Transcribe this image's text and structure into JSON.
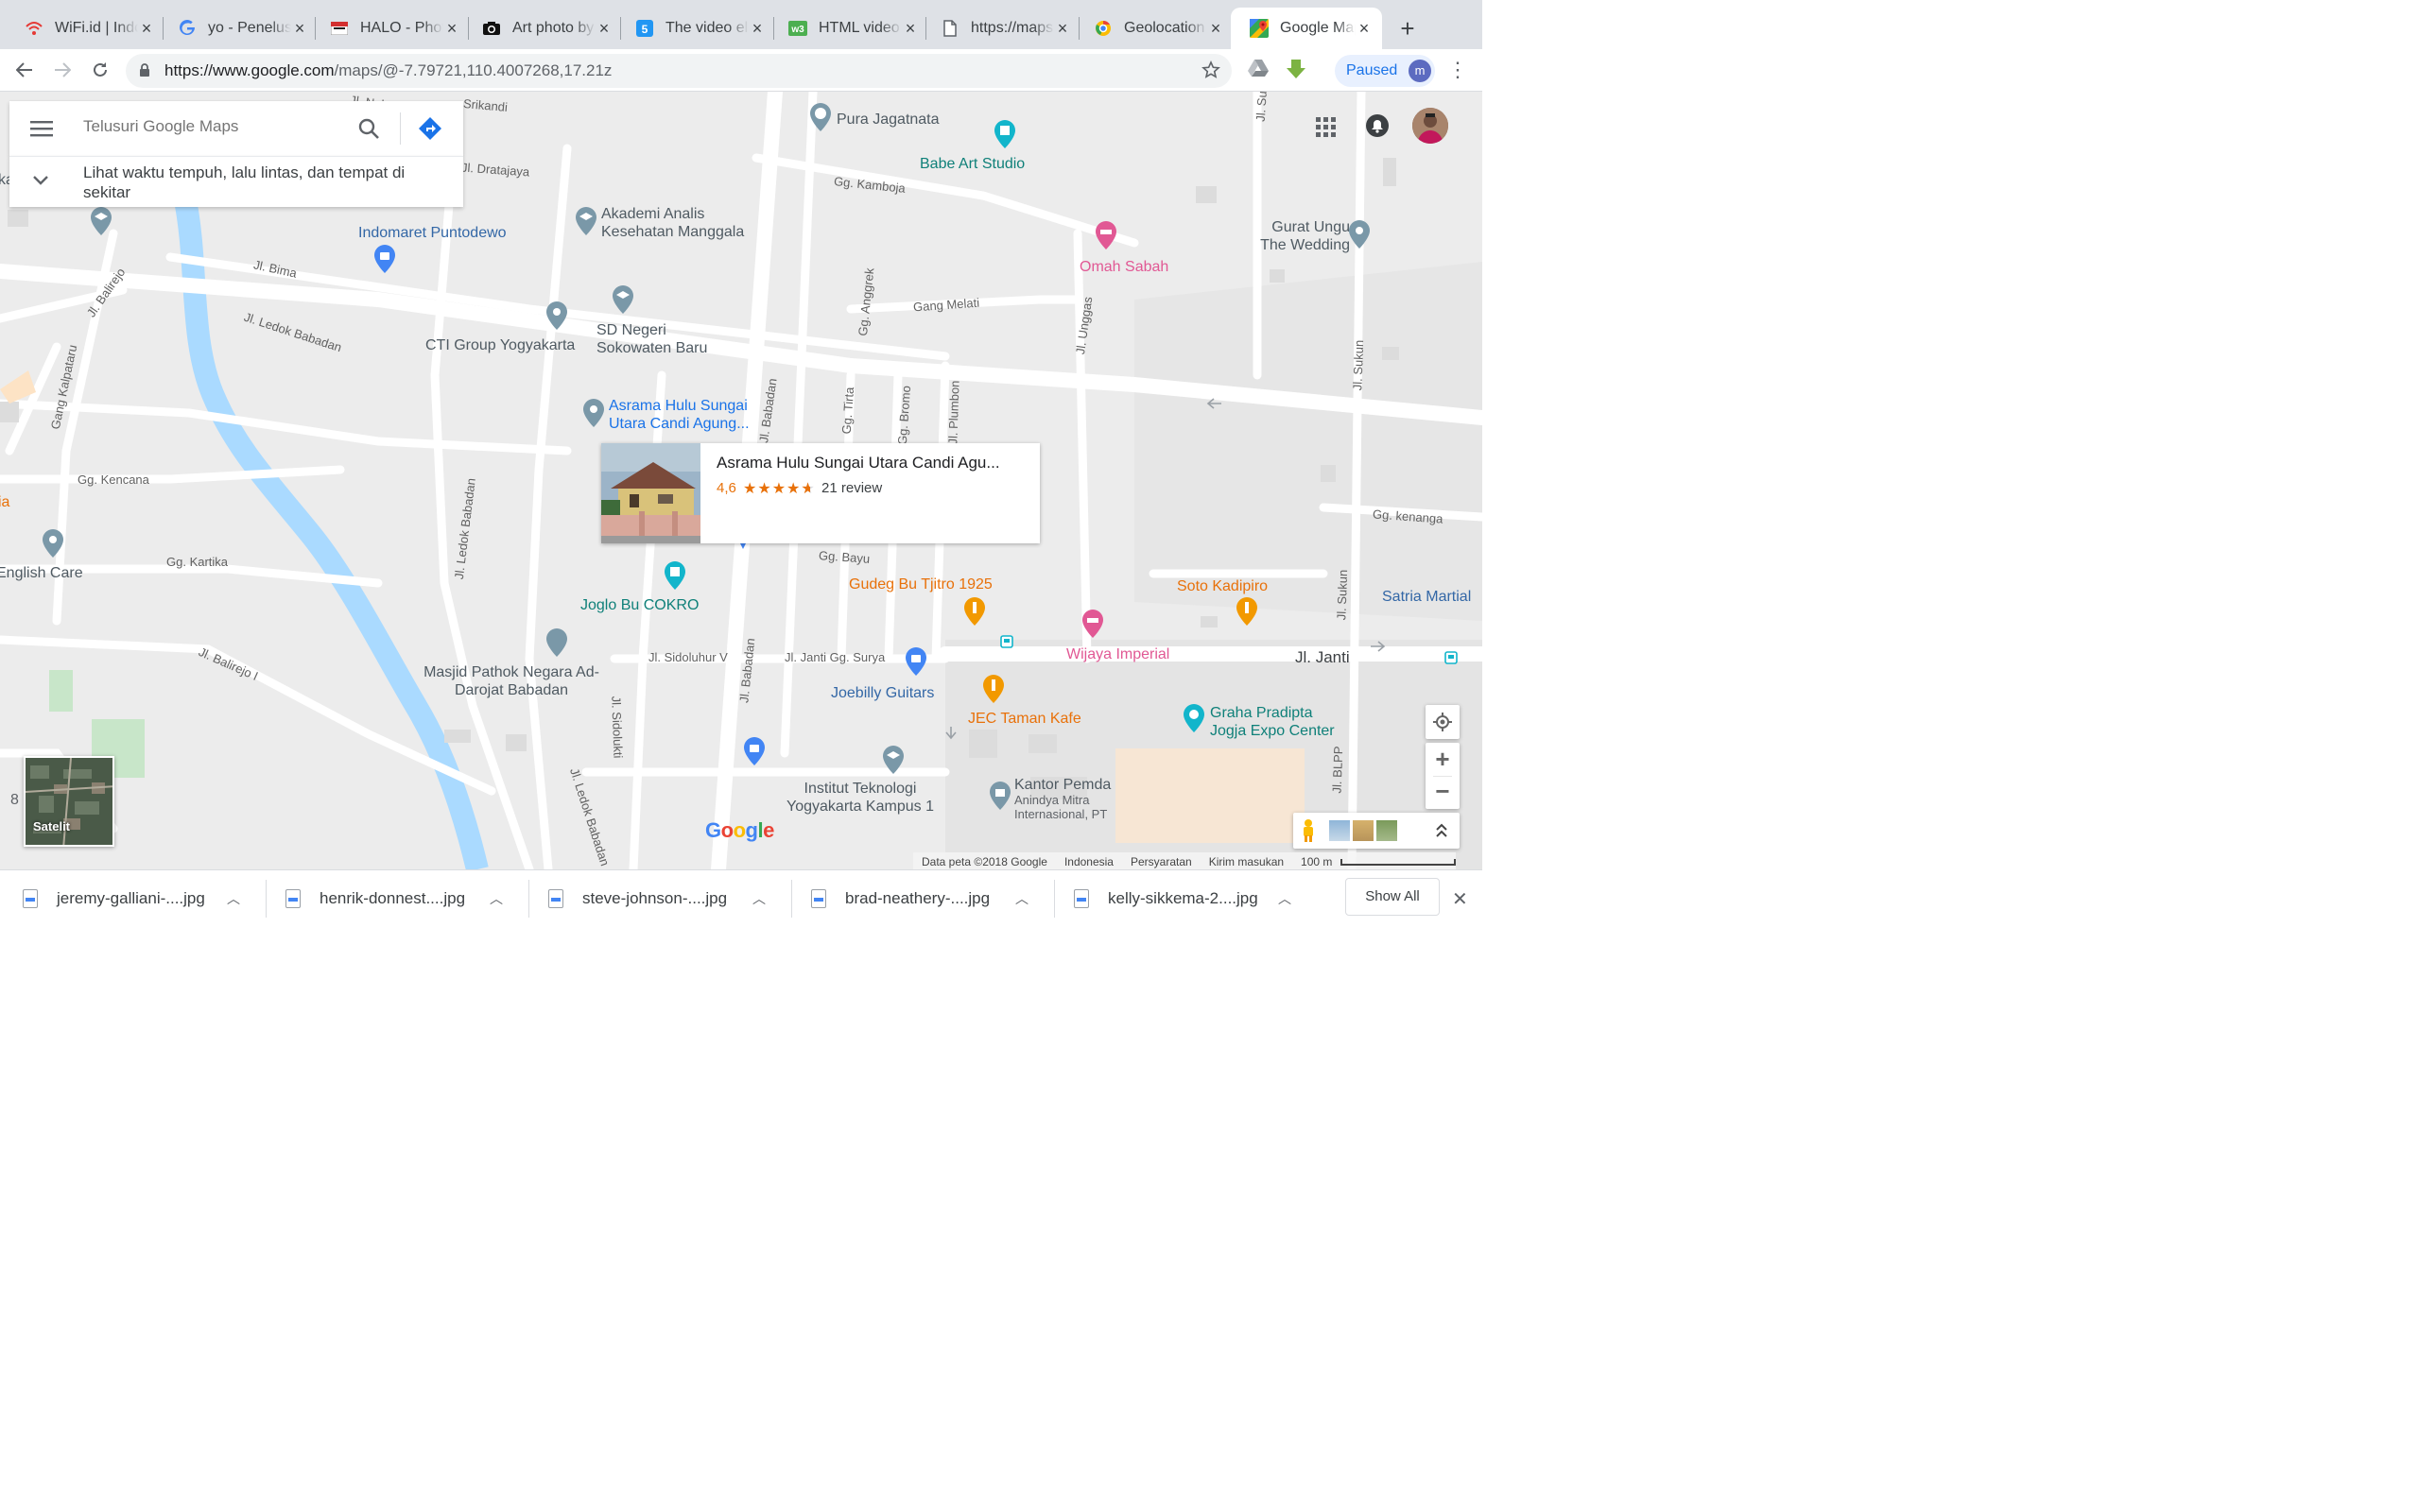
{
  "browser": {
    "tabs": [
      {
        "title": "WiFi.id | Indonesia",
        "favicon": "wifi-icon",
        "active": false
      },
      {
        "title": "yo - Penelusuran Google",
        "favicon": "google-icon",
        "active": false
      },
      {
        "title": "HALO - Photo",
        "favicon": "flag-icon",
        "active": false
      },
      {
        "title": "Art photo by",
        "favicon": "camera-icon",
        "active": false
      },
      {
        "title": "The video element",
        "favicon": "html5-icon",
        "active": false
      },
      {
        "title": "HTML video",
        "favicon": "w3-icon",
        "active": false
      },
      {
        "title": "https://maps",
        "favicon": "page-icon",
        "active": false
      },
      {
        "title": "Geolocation",
        "favicon": "chrome-icon",
        "active": false
      },
      {
        "title": "Google Maps",
        "favicon": "maps-icon",
        "active": true
      }
    ],
    "url_host": "https://www.google.com",
    "url_path": "/maps/@-7.79721,110.4007268,17.21z",
    "profile_status": "Paused",
    "profile_initial": "m"
  },
  "search": {
    "placeholder": "Telusuri Google Maps",
    "suggestion": "Lihat waktu tempuh, lalu lintas, dan tempat di sekitar"
  },
  "map": {
    "streets": [
      "Jl. Nakula",
      "Srikandi",
      "Jl. Dratajaya",
      "Jl. Bima",
      "Jl. Balirejo",
      "Jl. Ledok Babadan",
      "Gang Kalpataru",
      "Gg. Kencana",
      "Gg. Kartika",
      "Jl. Balirejo I",
      "Jl. Ledok Babadan",
      "Jl. Sidolukti",
      "Jl. Sidoluhur V",
      "Jl. Babadan",
      "Jl. Babadan",
      "Gg. Kamboja",
      "Gang Melati",
      "Gg. Anggrek",
      "Jl. Unggas",
      "Gg. Tirta",
      "Gg. Bromo",
      "Jl. Plumbon",
      "Gg. Bayu",
      "Jl. Janti Gg. Surya",
      "Jl. Janti",
      "Jl. Sukun",
      "Jl. Sukun",
      "Gg. kenanga",
      "Jl. BLPP",
      "Jl. Ledok Babadan",
      "Jl. Su"
    ],
    "places": [
      {
        "name": "Pura Jagatnata",
        "kind": "temple"
      },
      {
        "name": "Babe Art Studio",
        "kind": "museum"
      },
      {
        "name": "Akademi Analis Kesehatan Manggala",
        "kind": "school"
      },
      {
        "name": "Indomaret Puntodewo",
        "kind": "shop"
      },
      {
        "name": "Gurat Ungu The Wedding",
        "kind": "place"
      },
      {
        "name": "Omah Sabah",
        "kind": "hotel"
      },
      {
        "name": "CTI Group Yogyakarta",
        "kind": "place"
      },
      {
        "name": "SD Negeri Sokowaten Baru",
        "kind": "school"
      },
      {
        "name": "Asrama Hulu Sungai Utara Candi Agung...",
        "kind": "selected"
      },
      {
        "name": "English Care",
        "kind": "place"
      },
      {
        "name": "Joglo Bu COKRO",
        "kind": "museum"
      },
      {
        "name": "Gudeg Bu Tjitro 1925",
        "kind": "restaurant"
      },
      {
        "name": "Soto Kadipiro",
        "kind": "restaurant"
      },
      {
        "name": "Satria Martial",
        "kind": "place"
      },
      {
        "name": "Wijaya Imperial",
        "kind": "hotel"
      },
      {
        "name": "Masjid Pathok Negara Ad-Darojat Babadan",
        "kind": "mosque"
      },
      {
        "name": "Joebilly Guitars",
        "kind": "shop"
      },
      {
        "name": "JEC Taman Kafe",
        "kind": "restaurant"
      },
      {
        "name": "Graha Pradipta Jogja Expo Center",
        "kind": "venue"
      },
      {
        "name": "Institut Teknologi Yogyakarta Kampus 1",
        "kind": "school"
      },
      {
        "name": "Kantor Pemda",
        "kind": "government"
      },
      {
        "name": "Anindya Mitra Internasional, PT",
        "kind": "company"
      },
      {
        "name": "ia",
        "kind": "place"
      },
      {
        "name": "ka",
        "kind": "place"
      }
    ],
    "card": {
      "title": "Asrama Hulu Sungai Utara Candi Agu...",
      "rating": "4,6",
      "stars": 4.6,
      "reviews": "21 review"
    },
    "satellite_label": "Satelit",
    "edge_digit": "8",
    "attribution": {
      "data": "Data peta ©2018 Google",
      "country": "Indonesia",
      "terms": "Persyaratan",
      "feedback": "Kirim masukan",
      "scale": "100 m"
    }
  },
  "downloads": {
    "files": [
      "jeremy-galliani-....jpg",
      "henrik-donnest....jpg",
      "steve-johnson-....jpg",
      "brad-neathery-....jpg",
      "kelly-sikkema-2....jpg"
    ],
    "show_all": "Show All"
  },
  "colors": {
    "river": "#aadaff",
    "road": "#ffffff",
    "land": "#ececec",
    "accent": "#1a73e8"
  }
}
